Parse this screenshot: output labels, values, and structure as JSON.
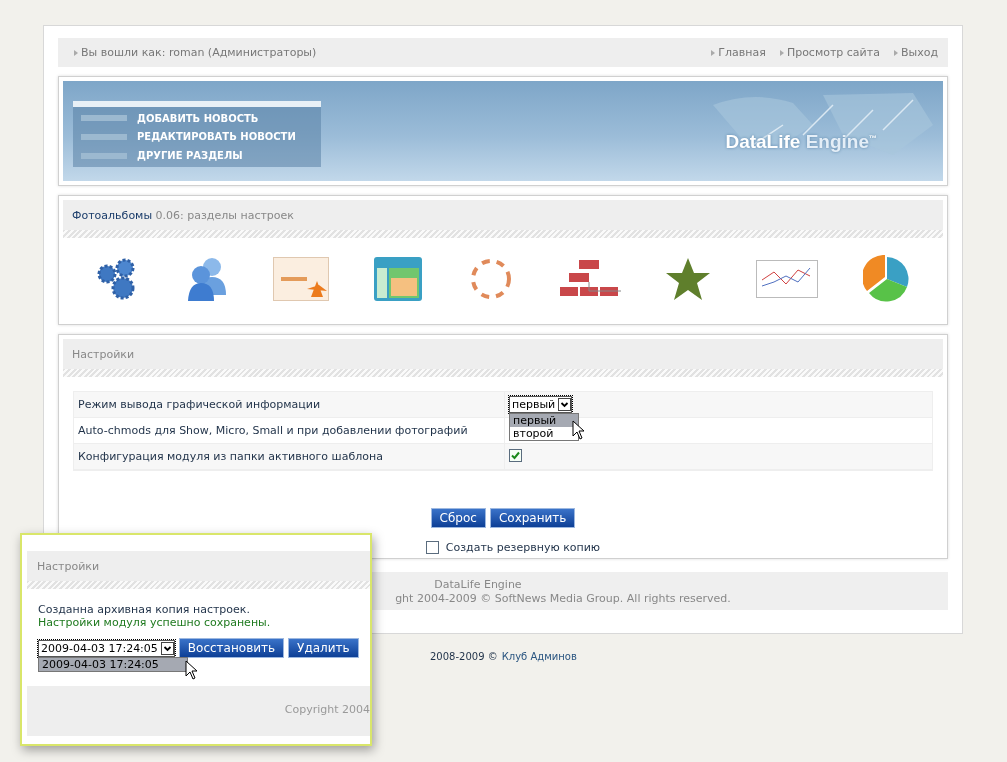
{
  "top_bar": {
    "user_text": "Вы вошли как: roman (Администраторы)",
    "links": [
      "Главная",
      "Просмотр сайта",
      "Выход"
    ]
  },
  "banner": {
    "menu": [
      "ДОБАВИТЬ НОВОСТЬ",
      "РЕДАКТИРОВАТЬ НОВОСТИ",
      "ДРУГИЕ РАЗДЕЛЫ"
    ],
    "logo_main": "DataLife",
    "logo_accent": "Engine",
    "trademark": "™"
  },
  "module_panel": {
    "title": "Фотоальбомы",
    "subtitle": "0.06: разделы настроек"
  },
  "settings": {
    "title": "Настройки",
    "rows": [
      {
        "label": "Режим вывода графической информации",
        "kind": "select",
        "value": "первый",
        "expanded": true,
        "options": [
          {
            "label": "первый",
            "selected": true
          },
          {
            "label": "второй",
            "selected": false
          }
        ]
      },
      {
        "label": "Auto-chmods для Show, Micro, Small и при добавлении фотографий",
        "kind": "empty"
      },
      {
        "label": "Конфигурация модуля из папки активного шаблона",
        "kind": "checkbox",
        "checked": true
      }
    ],
    "buttons": [
      "Сброс",
      "Сохранить"
    ],
    "backup": {
      "label": "Создать резервную копию",
      "checked": false
    }
  },
  "footer": {
    "title": "DataLife Engine",
    "copyright": "ght 2004-2009 © SoftNews Media Group. All rights reserved."
  },
  "credit": {
    "years": "2008-2009 ©",
    "link": "Клуб Админов"
  },
  "popup": {
    "title": "Настройки",
    "messages": [
      {
        "text": "Созданна архивная копия настроек.",
        "kind": "info"
      },
      {
        "text": "Настройки модуля успешно сохранены.",
        "kind": "success"
      }
    ],
    "select": {
      "value": "2009-04-03 17:24:05",
      "expanded": true,
      "options": [
        {
          "label": "2009-04-03 17:24:05",
          "selected": true
        }
      ]
    },
    "buttons": [
      "Восстановить",
      "Удалить"
    ],
    "footer": "Copyright 2004"
  }
}
